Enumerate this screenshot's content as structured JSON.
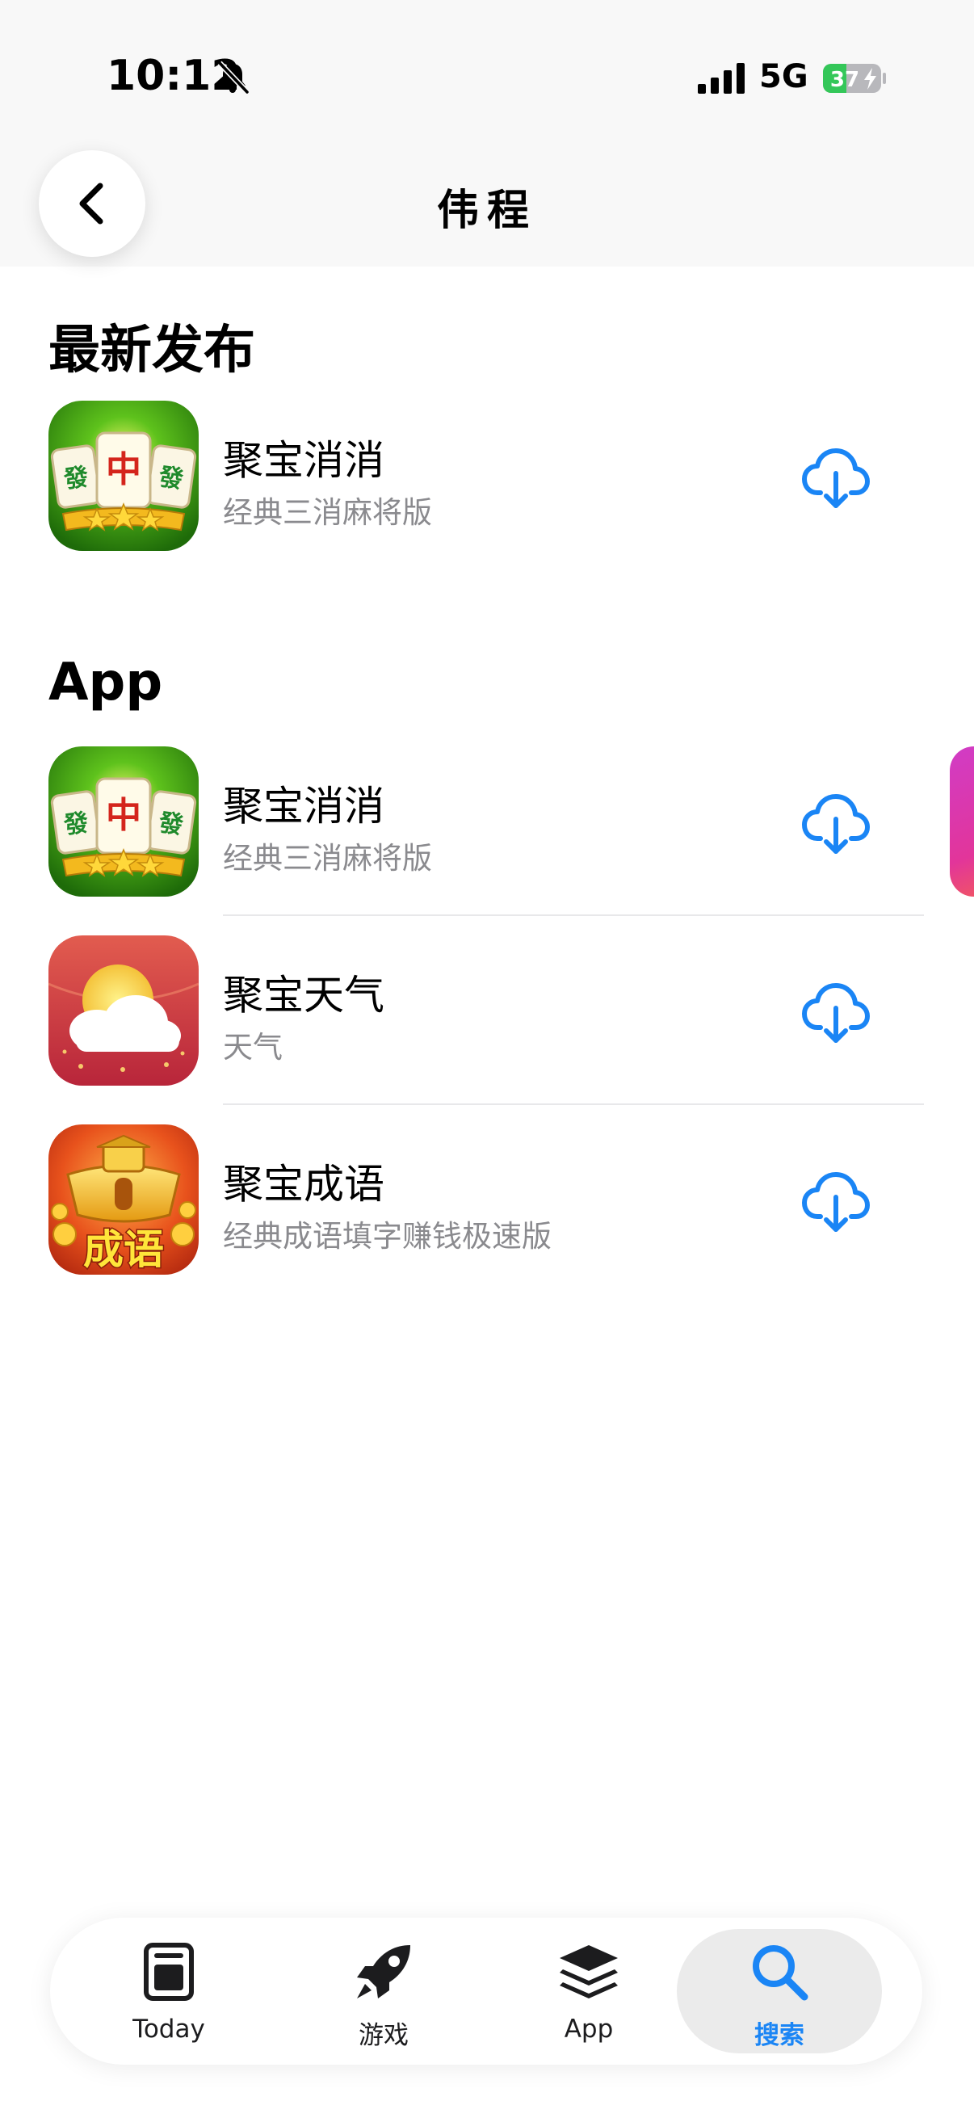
{
  "status_bar": {
    "time": "10:12",
    "network": "5G",
    "battery_level": "37"
  },
  "header": {
    "title": "伟程"
  },
  "sections": {
    "latest": {
      "heading": "最新发布",
      "items": [
        {
          "name": "聚宝消消",
          "subtitle": "经典三消麻将版",
          "icon": "mahjong-icon"
        }
      ]
    },
    "apps": {
      "heading": "App",
      "items": [
        {
          "name": "聚宝消消",
          "subtitle": "经典三消麻将版",
          "icon": "mahjong-icon"
        },
        {
          "name": "聚宝天气",
          "subtitle": "天气",
          "icon": "weather-icon"
        },
        {
          "name": "聚宝成语",
          "subtitle": "经典成语填字赚钱极速版",
          "icon": "idiom-icon"
        }
      ]
    }
  },
  "icon_text": {
    "mahjong_left": "發",
    "mahjong_center": "中",
    "mahjong_right": "發",
    "idiom_label": "成语"
  },
  "tab_bar": {
    "tabs": [
      {
        "label": "Today",
        "icon": "today-icon"
      },
      {
        "label": "游戏",
        "icon": "rocket-icon"
      },
      {
        "label": "App",
        "icon": "layers-icon"
      },
      {
        "label": "搜索",
        "icon": "search-icon",
        "active": true
      }
    ]
  },
  "colors": {
    "accent": "#1a85f5",
    "secondary_text": "#8a8a8e",
    "battery_fill": "#34c759"
  }
}
